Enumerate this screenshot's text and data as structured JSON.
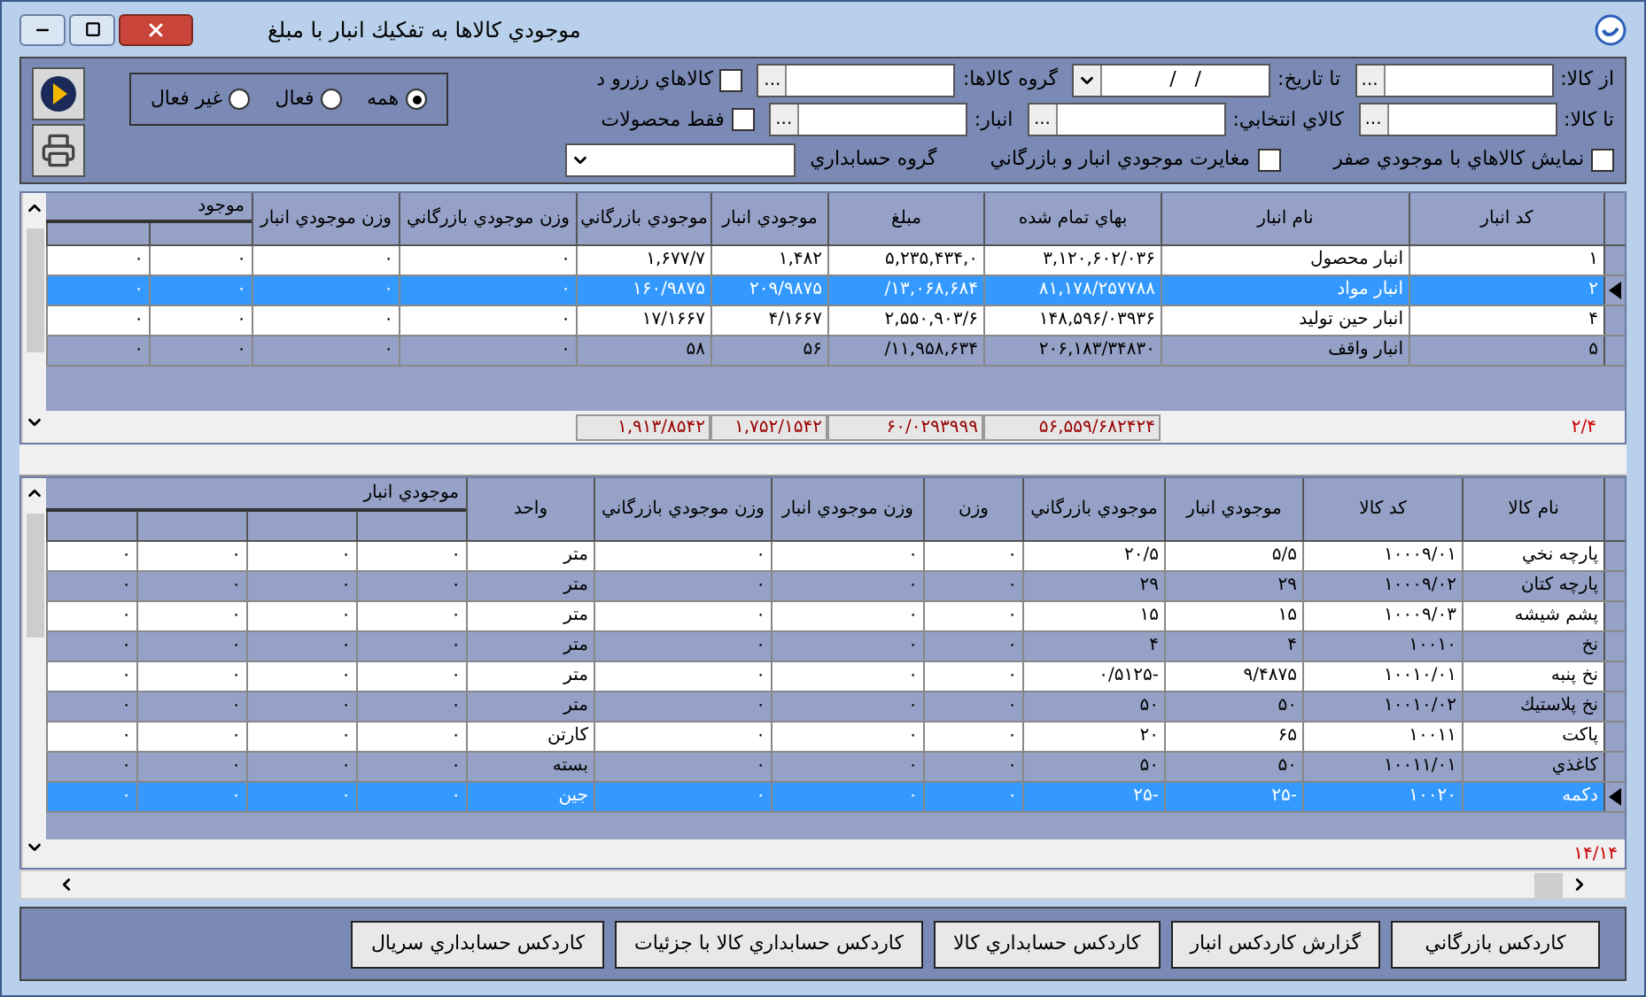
{
  "window": {
    "title": "موجودي كالاها به تفكيك انبار با مبلغ"
  },
  "filters": {
    "row_1": [
      {
        "kind": "lookup",
        "label": "از كالا:",
        "button": "..."
      },
      {
        "kind": "date",
        "label": "تا تاريخ:",
        "value": "/   /"
      },
      {
        "kind": "lookup",
        "label": "گروه كالاها:",
        "button": "..."
      },
      {
        "kind": "checkbox",
        "label": "كالاهاي رزرو د",
        "checked": false
      }
    ],
    "row_2": [
      {
        "kind": "lookup",
        "label": "تا كالا:",
        "button": "..."
      },
      {
        "kind": "lookup",
        "label": "كالاي انتخابي:",
        "button": "..."
      },
      {
        "kind": "lookup",
        "label": "انبار:",
        "button": "..."
      },
      {
        "kind": "checkbox",
        "label": "فقط محصولات",
        "checked": false
      }
    ],
    "row_3": [
      {
        "kind": "checkbox",
        "label": "نمايش كالاهاي با موجودي صفر",
        "checked": false
      },
      {
        "kind": "checkbox",
        "label": "مغايرت موجودي انبار و بازرگاني",
        "checked": false
      },
      {
        "kind": "select",
        "label": "گروه حسابداري"
      }
    ]
  },
  "status_filter": [
    {
      "label": "همه",
      "selected": true
    },
    {
      "label": "فعال",
      "selected": false
    },
    {
      "label": "غير فعال",
      "selected": false
    }
  ],
  "warehouse_grid": {
    "columns": [
      "كد انبار",
      "نام انبار",
      "بهاي تمام شده",
      "مبلغ",
      "موجودي انبار",
      "موجودي بازرگاني",
      "وزن موجودي بازرگاني",
      "وزن موجودي انبار"
    ],
    "group": {
      "label": "موجود"
    },
    "rows": [
      {
        "selected": false,
        "cells": [
          "۱",
          "انبار محصول",
          "۳,۱۲۰,۶۰۲/۰۳۶",
          "۵,۲۳۵,۴۳۴,۰",
          "۱,۴۸۲",
          "۱,۶۷۷/۷",
          "۰",
          "۰",
          "۰",
          "۰"
        ]
      },
      {
        "selected": true,
        "cells": [
          "۲",
          "انبار مواد",
          "۸۱,۱۷۸/۲۵۷۷۸۸",
          "۱۳,۰۶۸,۶۸۴/",
          "۲۰۹/۹۸۷۵",
          "۱۶۰/۹۸۷۵",
          "۰",
          "۰",
          "۰",
          "۰"
        ]
      },
      {
        "selected": false,
        "cells": [
          "۴",
          "انبار حين توليد",
          "۱۴۸,۵۹۶/۰۳۹۳۶",
          "۲,۵۵۰,۹۰۳/۶",
          "۴/۱۶۶۷",
          "۱۷/۱۶۶۷",
          "۰",
          "۰",
          "۰",
          "۰"
        ]
      },
      {
        "selected": false,
        "cells": [
          "۵",
          "انبار واقف",
          "۲۰۶,۱۸۳/۳۴۸۳۰",
          "۱۱,۹۵۸,۶۳۴/",
          "۵۶",
          "۵۸",
          "۰",
          "۰",
          "۰",
          "۰"
        ]
      }
    ],
    "count": "۲/۴",
    "totals": [
      "۵۶,۵۵۹/۶۸۲۴۲۴",
      "۶۰/۰۲۹۳۹۹۹",
      "۱,۷۵۲/۱۵۴۲",
      "۱,۹۱۳/۸۵۴۲"
    ]
  },
  "item_grid": {
    "columns": [
      "نام كالا",
      "كد كالا",
      "موجودي انبار",
      "موجودي بازرگاني",
      "وزن",
      "وزن موجودي انبار",
      "وزن موجودي بازرگاني",
      "واحد"
    ],
    "group": {
      "label": "موجودي انبار"
    },
    "rows": [
      {
        "selected": false,
        "cells": [
          "پارچه نخي",
          "۱۰۰۰۹/۰۱",
          "۵/۵",
          "۲۰/۵",
          "۰",
          "۰",
          "۰",
          "متر",
          "۰",
          "۰",
          "۰",
          "۰"
        ]
      },
      {
        "selected": false,
        "cells": [
          "پارچه كتان",
          "۱۰۰۰۹/۰۲",
          "۲۹",
          "۲۹",
          "۰",
          "۰",
          "۰",
          "متر",
          "۰",
          "۰",
          "۰",
          "۰"
        ]
      },
      {
        "selected": false,
        "cells": [
          "پشم شيشه",
          "۱۰۰۰۹/۰۳",
          "۱۵",
          "۱۵",
          "۰",
          "۰",
          "۰",
          "متر",
          "۰",
          "۰",
          "۰",
          "۰"
        ]
      },
      {
        "selected": false,
        "cells": [
          "نخ",
          "۱۰۰۱۰",
          "۴",
          "۴",
          "۰",
          "۰",
          "۰",
          "متر",
          "۰",
          "۰",
          "۰",
          "۰"
        ]
      },
      {
        "selected": false,
        "cells": [
          "نخ پنبه",
          "۱۰۰۱۰/۰۱",
          "۹/۴۸۷۵",
          "-۰/۵۱۲۵",
          "۰",
          "۰",
          "۰",
          "متر",
          "۰",
          "۰",
          "۰",
          "۰"
        ]
      },
      {
        "selected": false,
        "cells": [
          "نخ پلاستيك",
          "۱۰۰۱۰/۰۲",
          "۵۰",
          "۵۰",
          "۰",
          "۰",
          "۰",
          "متر",
          "۰",
          "۰",
          "۰",
          "۰"
        ]
      },
      {
        "selected": false,
        "cells": [
          "پاكت",
          "۱۰۰۱۱",
          "۶۵",
          "۲۰",
          "۰",
          "۰",
          "۰",
          "كارتن",
          "۰",
          "۰",
          "۰",
          "۰"
        ]
      },
      {
        "selected": false,
        "cells": [
          "كاغذي",
          "۱۰۰۱۱/۰۱",
          "۵۰",
          "۵۰",
          "۰",
          "۰",
          "۰",
          "بسته",
          "۰",
          "۰",
          "۰",
          "۰"
        ]
      },
      {
        "selected": true,
        "cells": [
          "دكمه",
          "۱۰۰۲۰",
          "-۲۵",
          "-۲۵",
          "۰",
          "۰",
          "۰",
          "جين",
          "۰",
          "۰",
          "۰",
          "۰"
        ]
      }
    ],
    "count": "۱۴/۱۴"
  },
  "buttons": [
    "كاردكس بازرگاني",
    "گزارش كاردكس انبار",
    "كاردكس حسابداري كالا",
    "كاردكس حسابداري كالا با جزئيات",
    "كاردكس حسابداري سريال"
  ]
}
